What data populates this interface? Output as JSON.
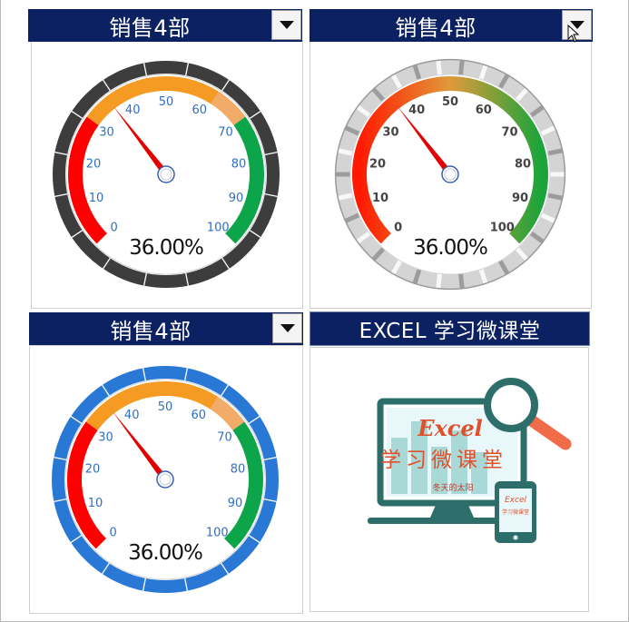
{
  "panels": [
    {
      "title": "销售4部",
      "dropdown": "chevron-down-icon"
    },
    {
      "title": "销售4部",
      "dropdown": "chevron-down-icon"
    },
    {
      "title": "销售4部",
      "dropdown": "chevron-down-icon"
    },
    {
      "title": "EXCEL 学习微课堂"
    }
  ],
  "chart_data": [
    {
      "type": "gauge",
      "style": "dark-bezel",
      "min": 0,
      "max": 100,
      "value": 36,
      "value_label": "36.00%",
      "ticks": [
        "0",
        "10",
        "20",
        "30",
        "40",
        "50",
        "60",
        "70",
        "80",
        "90",
        "100"
      ],
      "bands": [
        {
          "from": 0,
          "to": 30,
          "color": "#ff0000"
        },
        {
          "from": 30,
          "to": 70,
          "color": "#f59a23"
        },
        {
          "from": 70,
          "to": 100,
          "color": "#0ca54a"
        }
      ],
      "bezel_color": "#3d3d3d",
      "tick_label_color": "#2f6fc1"
    },
    {
      "type": "gauge",
      "style": "silver-bezel-gradient",
      "min": 0,
      "max": 100,
      "value": 36,
      "value_label": "36.00%",
      "ticks": [
        "0",
        "10",
        "20",
        "30",
        "40",
        "50",
        "60",
        "70",
        "80",
        "90",
        "100"
      ],
      "bands": [
        {
          "from": 0,
          "to": 100,
          "color_start": "#ff1a00",
          "color_end": "#1aa43a"
        }
      ],
      "bezel_color": "#b7b7b7",
      "tick_label_color": "#444444"
    },
    {
      "type": "gauge",
      "style": "blue-bezel",
      "min": 0,
      "max": 100,
      "value": 36,
      "value_label": "36.00%",
      "ticks": [
        "0",
        "10",
        "20",
        "30",
        "40",
        "50",
        "60",
        "70",
        "80",
        "90",
        "100"
      ],
      "bands": [
        {
          "from": 0,
          "to": 30,
          "color": "#ff0000"
        },
        {
          "from": 30,
          "to": 70,
          "color": "#f59a23"
        },
        {
          "from": 70,
          "to": 100,
          "color": "#0ca54a"
        }
      ],
      "bezel_color": "#2a78d6",
      "tick_label_color": "#2f6fc1"
    }
  ],
  "logo": {
    "line1": "Excel",
    "line2": "学习微课堂",
    "line3": "冬天的太阳",
    "phone_line1": "Excel",
    "phone_line2": "学习微课堂"
  },
  "colors": {
    "header_bg": "#0c2161",
    "needle": "#e30000"
  }
}
